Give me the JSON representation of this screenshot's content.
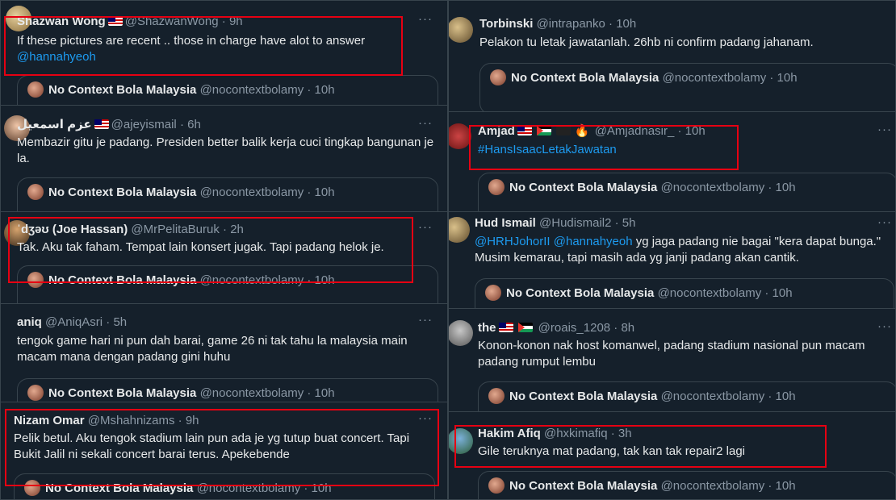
{
  "more_glyph": "···",
  "quote_card": {
    "name": "No Context Bola Malaysia",
    "handle": "@nocontextbolamy",
    "sep": "·",
    "time": "10h"
  },
  "left_tweets": [
    {
      "name": "Shazwan Wong",
      "flags": [
        "malaysia"
      ],
      "handle": "@ShazwanWong",
      "time": "9h",
      "text": "If these pictures are recent .. those in charge have alot to answer",
      "mention": "@hannahyeoh"
    },
    {
      "name": "عزم اسمعيل",
      "flags": [
        "malaysia"
      ],
      "handle": "@ajeyismail",
      "time": "6h",
      "text": "Membazir gitu je padang. Presiden better balik kerja cuci tingkap bangunan je la."
    },
    {
      "name": "ˈdʒəʊ (Joe Hassan)",
      "handle": "@MrPelitaBuruk",
      "time": "2h",
      "text": "Tak. Aku tak faham. Tempat lain konsert jugak. Tapi padang helok je."
    },
    {
      "name": "aniq",
      "handle": "@AniqAsri",
      "time": "5h",
      "text": "tengok game hari ni pun dah barai, game 26 ni tak tahu la malaysia main macam mana dengan padang gini huhu"
    },
    {
      "name": "Nizam Omar",
      "handle": "@Mshahnizams",
      "time": "9h",
      "text": "Pelik betul. Aku tengok stadium lain pun ada je yg tutup buat concert. Tapi Bukit Jalil ni sekali concert barai terus. Apekebende"
    }
  ],
  "right_tweets": [
    {
      "name": "Torbinski",
      "handle": "@intrapanko",
      "time": "10h",
      "text": "Pelakon tu letak jawatanlah. 26hb ni confirm padang jahanam."
    },
    {
      "name": "Amjad",
      "flags": [
        "malaysia",
        "palestine",
        "dark"
      ],
      "fire": "🔥",
      "handle": "@Amjadnasir_",
      "time": "10h",
      "hashtag": "#HansIsaacLetakJawatan"
    },
    {
      "name": "Hud Ismail",
      "handle": "@Hudismail2",
      "time": "5h",
      "mentions": "@HRHJohorII @hannahyeoh",
      "text": " yg jaga padang nie bagai \"kera dapat bunga.\" Musim kemarau, tapi masih ada yg janji padang akan cantik."
    },
    {
      "name": "the",
      "flags": [
        "malaysia",
        "palestine"
      ],
      "handle": "@roais_1208",
      "time": "8h",
      "text": "Konon-konon nak host komanwel, padang stadium nasional pun macam padang rumput lembu"
    },
    {
      "name": "Hakim Afiq",
      "handle": "@hxkimafiq",
      "time": "3h",
      "text": "Gile teruknya mat padang, tak kan tak repair2 lagi"
    }
  ]
}
